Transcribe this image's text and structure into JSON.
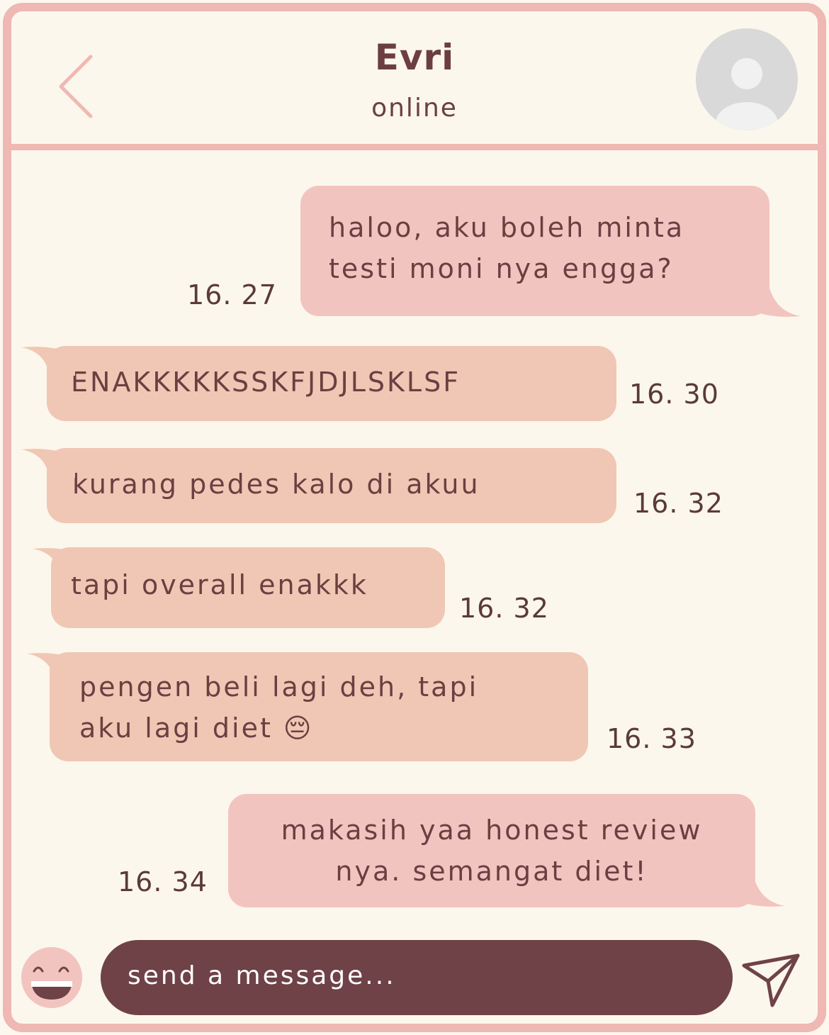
{
  "header": {
    "contact_name": "Evri",
    "status": "online"
  },
  "messages": [
    {
      "side": "sent",
      "lines": [
        "haloo, aku boleh minta",
        "testi moni nya engga?"
      ],
      "time": "16. 27"
    },
    {
      "side": "received",
      "lines": [
        "ENAKKKKKSSKFJDJLSKLSF"
      ],
      "time": "16. 30"
    },
    {
      "side": "received",
      "lines": [
        "kurang pedes kalo di akuu"
      ],
      "time": "16. 32"
    },
    {
      "side": "received",
      "lines": [
        "tapi overall enakkk"
      ],
      "time": "16. 32"
    },
    {
      "side": "received",
      "lines": [
        "pengen beli lagi deh, tapi",
        "aku lagi diet 😔"
      ],
      "time": "16. 33"
    },
    {
      "side": "sent",
      "lines": [
        "makasih yaa honest review",
        "nya. semangat diet!"
      ],
      "time": "16. 34"
    }
  ],
  "composer": {
    "placeholder": "send a message..."
  },
  "icons": {
    "back": "chevron-left-icon",
    "avatar": "user-avatar-icon",
    "emoji": "smiley-face-icon",
    "send": "paper-plane-icon"
  },
  "colors": {
    "frame_border": "#efb8b3",
    "background": "#fcf7ec",
    "sent_bubble": "#f2c4c0",
    "received_bubble": "#f0c7b4",
    "input_bg": "#6e4247",
    "text": "#6b3f42"
  }
}
